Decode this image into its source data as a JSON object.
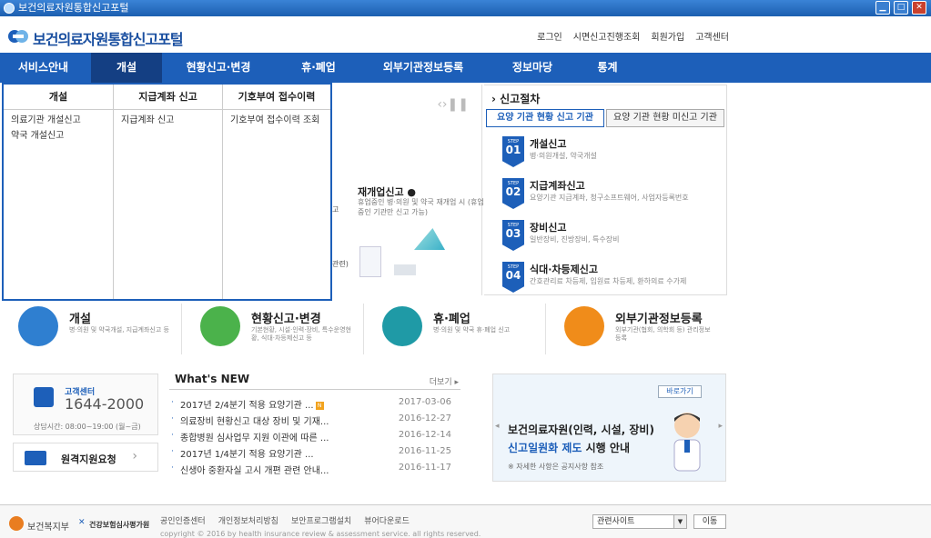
{
  "window": {
    "title": "보건의료자원통합신고포털"
  },
  "header": {
    "logo_text": "보건의료자원통합신고포털",
    "links": [
      "로그인",
      "시면신고진행조회",
      "회원가입",
      "고객센터"
    ]
  },
  "nav": {
    "items": [
      "서비스안내",
      "개설",
      "현황신고·변경",
      "휴·폐업",
      "외부기관정보등록",
      "정보마당",
      "통계"
    ],
    "active": "개설"
  },
  "dropdown": {
    "columns": [
      {
        "header": "개설",
        "items": [
          "의료기관 개설신고",
          "약국 개설신고"
        ]
      },
      {
        "header": "지급계좌 신고",
        "items": [
          "지급계좌 신고"
        ]
      },
      {
        "header": "기호부여 접수이력",
        "items": [
          "기호부여 접수이력 조회"
        ]
      }
    ]
  },
  "banner": {
    "title": "재개업신고 ●",
    "desc": "휴업중인 병·의원 및 약국 재개업 시 (휴업중인 기관만 신고 가능)",
    "cut_text_1": "고",
    "cut_text_2": "관련)"
  },
  "procedure": {
    "title": "신고절차",
    "tabs": [
      "요양 기관 현황 신고 기관",
      "요양 기관 현황 미신고 기관"
    ],
    "steps": [
      {
        "step": "STEP",
        "num": "01",
        "title": "개설신고",
        "desc": "병·의원개설, 약국개설"
      },
      {
        "step": "STEP",
        "num": "02",
        "title": "지급계좌신고",
        "desc": "요양기관 지급계좌, 청구소프트웨어, 사업자등록번호"
      },
      {
        "step": "STEP",
        "num": "03",
        "title": "장비신고",
        "desc": "일반장비, 진방장비, 특수장비"
      },
      {
        "step": "STEP",
        "num": "04",
        "title": "식대·차등제신고",
        "desc": "간호관리료 차등제, 입원료 차등제, 환하의료 수가제"
      }
    ]
  },
  "services": [
    {
      "title": "개설",
      "desc": "병·의원 및 약국개설, 지급계좌신고 등",
      "color": "#2f7fd0"
    },
    {
      "title": "현황신고·변경",
      "desc": "기본현황, 시설·인력·장비, 특수운영현황, 식대·차등제신고 등",
      "color": "#4bb24b"
    },
    {
      "title": "휴·폐업",
      "desc": "병·의원 및 약국 휴·폐업 신고",
      "color": "#1f9aa6"
    },
    {
      "title": "외부기관정보등록",
      "desc": "외부기관(협회, 의학회 등) 관리정보 등록",
      "color": "#f08c1a"
    }
  ],
  "customer": {
    "label": "고객센터",
    "phone": "1644-2000",
    "hours": "상담시간: 08:00~19:00 (월~금)"
  },
  "remote": {
    "label": "원격지원요청"
  },
  "news": {
    "title": "What's NEW",
    "more": "더보기 ▸",
    "items": [
      {
        "title": "2017년 2/4분기 적용 요양기관 ...",
        "date": "2017-03-06",
        "new": "N"
      },
      {
        "title": "의료장비 현황신고 대상 장비 및 기재...",
        "date": "2016-12-27",
        "new": ""
      },
      {
        "title": "종합병원 심사업무 지원 이관에 따른 ...",
        "date": "2016-12-14",
        "new": ""
      },
      {
        "title": "2017년 1/4분기 적용 요양기관 ...",
        "date": "2016-11-25",
        "new": ""
      },
      {
        "title": "신생아 중환자실 고시 개편 관련 안내...",
        "date": "2016-11-17",
        "new": ""
      }
    ]
  },
  "notice": {
    "button": "바로가기",
    "line1": "보건의료자원(인력, 시설, 장비)",
    "line2_highlight": "신고일원화 제도",
    "line2_rest": " 시행 안내",
    "line3": "※ 자세한 사항은 공지사항 참조"
  },
  "footer": {
    "org1": "보건복지부",
    "org2_mark": "✕",
    "org2": "건강보험심사평가원",
    "links": [
      "공인인증센터",
      "개인정보처리방침",
      "보안프로그램설치",
      "뷰어다운로드"
    ],
    "copyright": "copyright © 2016 by health insurance review & assessment service. all rights reserved.",
    "select": "관련사이트",
    "go": "이동"
  }
}
